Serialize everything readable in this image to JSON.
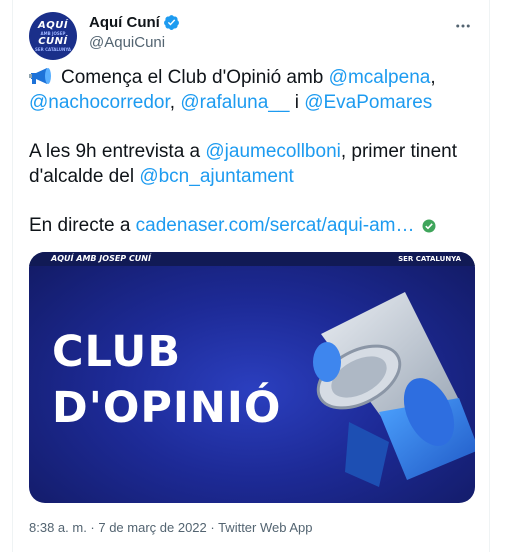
{
  "author": {
    "display_name": "Aquí Cuní",
    "handle": "@AquiCuni",
    "avatar_text": [
      "AQUÍ",
      "AMB JOSEP",
      "CUNÍ",
      "SER CATALUNYA"
    ]
  },
  "tweet": {
    "line1_prefix": "Comença el Club d'Opinió amb ",
    "mention_1": "@mcalpena",
    "sep_1": ",",
    "mention_2": "@nachocorredor",
    "sep_2": ", ",
    "mention_3": "@rafaluna__",
    "sep_3": " i ",
    "mention_4": "@EvaPomares",
    "line2_prefix": "A les 9h entrevista a ",
    "mention_5": "@jaumecollboni",
    "line2_mid": ", primer tinent d'alcalde del ",
    "mention_6": "@bcn_ajuntament",
    "line3_prefix": "En directe a ",
    "link": "cadenaser.com/sercat/aqui-am…"
  },
  "card": {
    "header_left": "AQUÍ AMB JOSEP CUNÍ",
    "header_right": "SER CATALUNYA",
    "title": "CLUB\nD'OPINIÓ"
  },
  "meta": {
    "timestamp": "8:38 a. m. · 7 de març de 2022 · Twitter Web App"
  },
  "colors": {
    "link": "#1d9bf0",
    "verified": "#1d9bf0",
    "card_bg": "#1d2a96"
  },
  "icons": {
    "verified": "verified-badge-icon",
    "more": "more-horizontal-icon",
    "emoji": "megaphone-emoji-icon",
    "link_check": "check-circle-icon"
  }
}
